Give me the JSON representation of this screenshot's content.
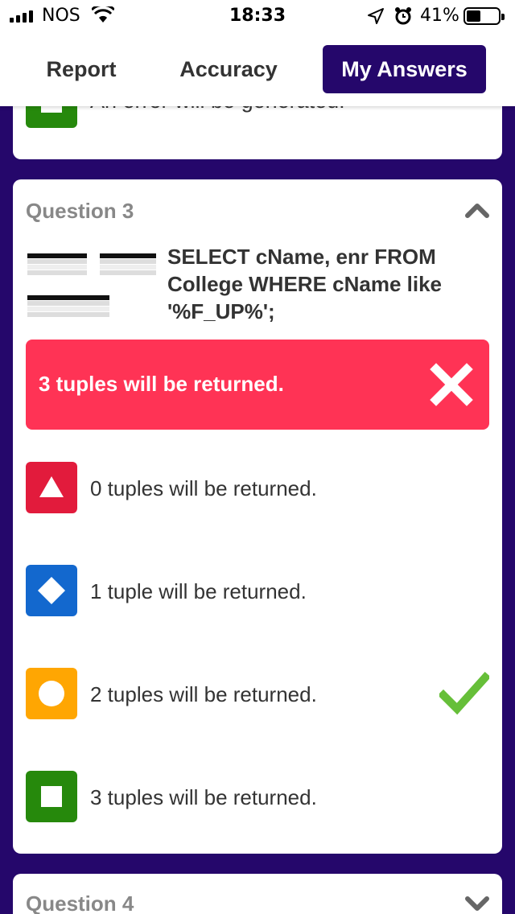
{
  "status_bar": {
    "carrier": "NOS",
    "time": "18:33",
    "battery_percent": "41%",
    "battery_level": 0.41,
    "icons": [
      "signal-icon",
      "wifi-icon",
      "location-icon",
      "alarm-icon",
      "battery-icon"
    ]
  },
  "tabs": [
    {
      "label": "Report",
      "active": false
    },
    {
      "label": "Accuracy",
      "active": false
    },
    {
      "label": "My Answers",
      "active": true
    }
  ],
  "previous_card": {
    "option_label": "An error will be generated.",
    "color": "#26890c",
    "icon": "square-icon"
  },
  "question3": {
    "title": "Question 3",
    "text": "SELECT cName, enr FROM College WHERE cName like '%F_UP%';",
    "user_answer": {
      "label": "3 tuples will be returned.",
      "correct": false,
      "color": "#ff3355",
      "icon": "x-icon"
    },
    "options": [
      {
        "label": "0 tuples will be returned.",
        "color": "#e21b3c",
        "icon": "triangle-icon",
        "correct": false
      },
      {
        "label": "1 tuple will be returned.",
        "color": "#1368ce",
        "icon": "diamond-icon",
        "correct": false
      },
      {
        "label": "2 tuples will be returned.",
        "color": "#ffa602",
        "icon": "circle-icon",
        "correct": true
      },
      {
        "label": "3 tuples will be returned.",
        "color": "#26890c",
        "icon": "square-icon",
        "correct": false
      }
    ]
  },
  "question4": {
    "title": "Question 4"
  },
  "colors": {
    "background": "#25076b",
    "accent": "#25076b",
    "check": "#66bf39"
  }
}
